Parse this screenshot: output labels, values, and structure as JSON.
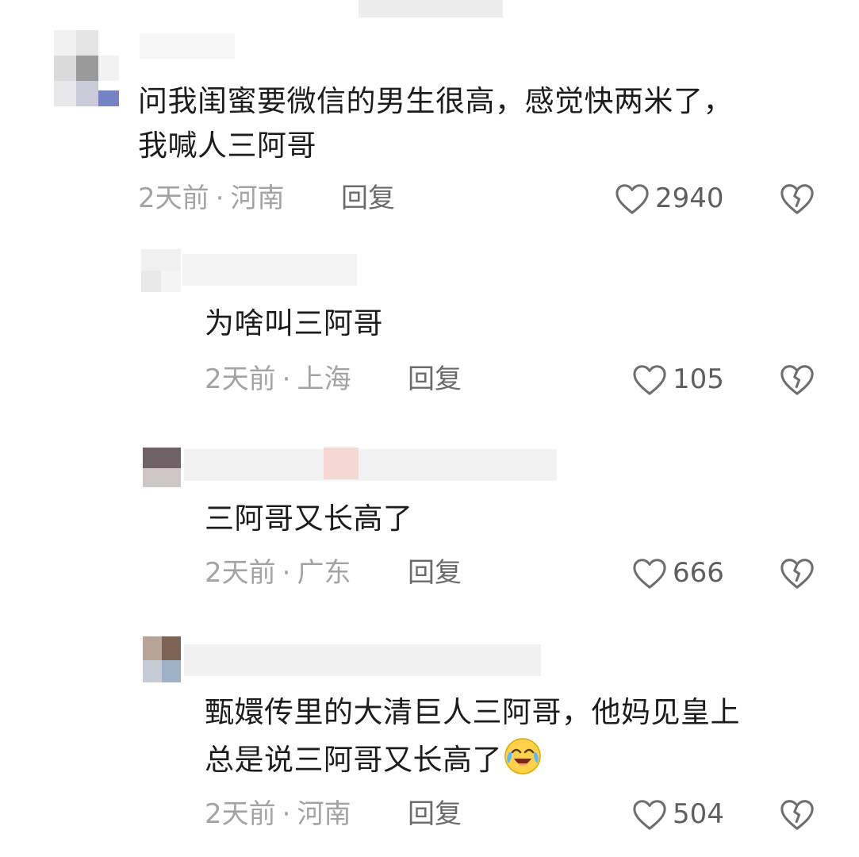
{
  "comments": [
    {
      "text_lines": [
        "问我闺蜜要微信的男生很高，感觉快两米了，",
        "我喊人三阿哥"
      ],
      "time": "2天前",
      "location": "河南",
      "reply_label": "回复",
      "likes": "2940"
    },
    {
      "text_lines": [
        "为啥叫三阿哥"
      ],
      "time": "2天前",
      "location": "上海",
      "reply_label": "回复",
      "likes": "105"
    },
    {
      "text_lines": [
        "三阿哥又长高了"
      ],
      "time": "2天前",
      "location": "广东",
      "reply_label": "回复",
      "likes": "666"
    },
    {
      "text_lines": [
        "甄嬛传里的大清巨人三阿哥，他妈见皇上",
        "总是说三阿哥又长高了"
      ],
      "time": "2天前",
      "location": "河南",
      "reply_label": "回复",
      "likes": "504"
    }
  ],
  "separator": "·",
  "colors": {
    "text": "#1c1c1c",
    "meta": "#a3a3a3",
    "reply": "#6b6b6b",
    "icon": "#6e6e6e"
  },
  "icons": {
    "like": "heart-outline-icon",
    "dislike": "broken-heart-icon",
    "emoji": "crying-laughing-emoji-icon"
  }
}
